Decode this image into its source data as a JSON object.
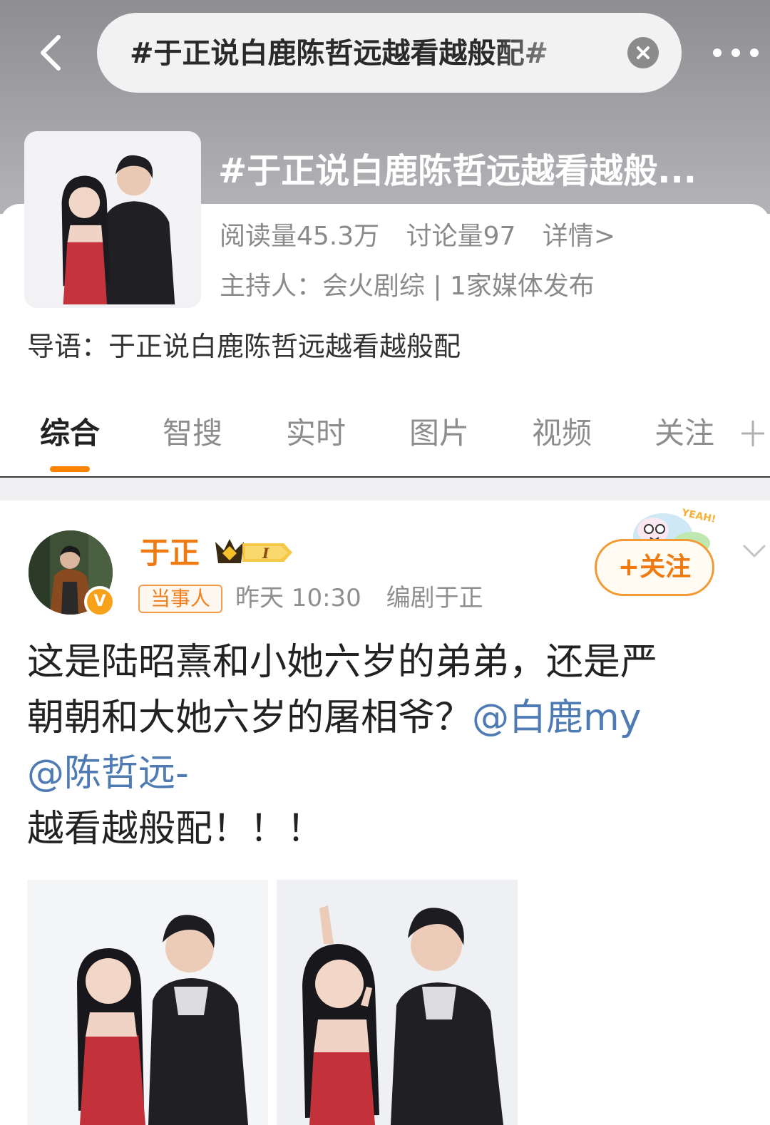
{
  "header": {
    "search_text": "#于正说白鹿陈哲远越看越般配#",
    "topic_title": "#于正说白鹿陈哲远越看越般..."
  },
  "topic": {
    "read_count": "阅读量45.3万",
    "discuss_count": "讨论量97",
    "details_link": "详情>",
    "host_line": "主持人：会火剧综 | 1家媒体发布",
    "intro": "导语：于正说白鹿陈哲远越看越般配"
  },
  "tabs": [
    "综合",
    "智搜",
    "实时",
    "图片",
    "视频",
    "关注"
  ],
  "post": {
    "author": "于正",
    "role_tag": "当事人",
    "time": "昨天 10:30",
    "source": "编剧于正",
    "follow_label": "+关注",
    "text_line1": "这是陆昭熹和小她六岁的弟弟，还是严",
    "text_line2_plain": "朝朝和大她六岁的屠相爷？",
    "mention1": "@白鹿my",
    "mention2": "@陈哲远-",
    "text_line4": "越看越般配！！！"
  },
  "colors": {
    "accent": "#ff8200",
    "author_name": "#f07a12",
    "mention": "#4f7bb5",
    "header_gray": "#a3a3a7"
  }
}
